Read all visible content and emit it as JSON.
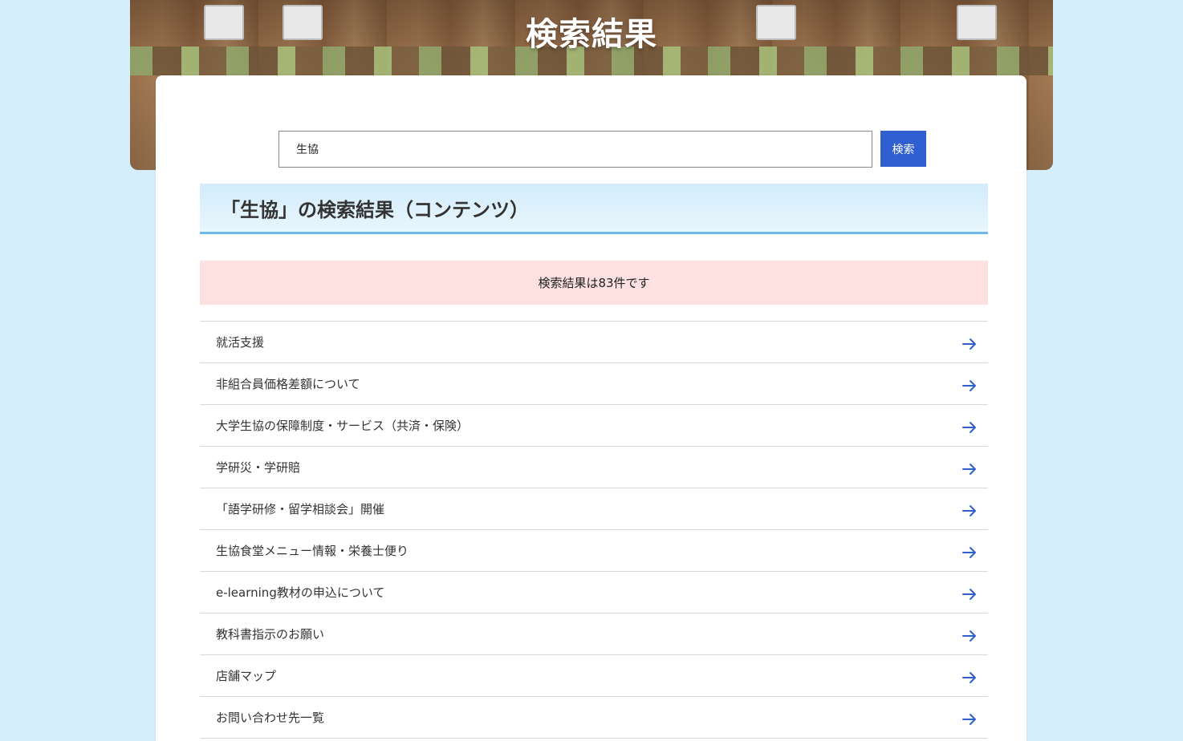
{
  "hero": {
    "title": "検索結果"
  },
  "search": {
    "value": "生協",
    "button_label": "検索"
  },
  "section": {
    "heading": "「生協」の検索結果（コンテンツ）"
  },
  "results": {
    "count_text": "検索結果は83件です",
    "items": [
      {
        "label": "就活支援"
      },
      {
        "label": "非組合員価格差額について"
      },
      {
        "label": "大学生協の保障制度・サービス（共済・保険）"
      },
      {
        "label": "学研災・学研賠"
      },
      {
        "label": "「語学研修・留学相談会」開催"
      },
      {
        "label": "生協食堂メニュー情報・栄養士便り"
      },
      {
        "label": "e-learning教材の申込について"
      },
      {
        "label": "教科書指示のお願い"
      },
      {
        "label": "店舗マップ"
      },
      {
        "label": "お問い合わせ先一覧"
      }
    ]
  },
  "colors": {
    "page_background": "#d5eefb",
    "accent_blue": "#2f5fd0",
    "heading_border": "#6cb8e8",
    "count_background": "#fde0e0"
  },
  "icons": {
    "result_arrow": "arrow-right-icon"
  }
}
